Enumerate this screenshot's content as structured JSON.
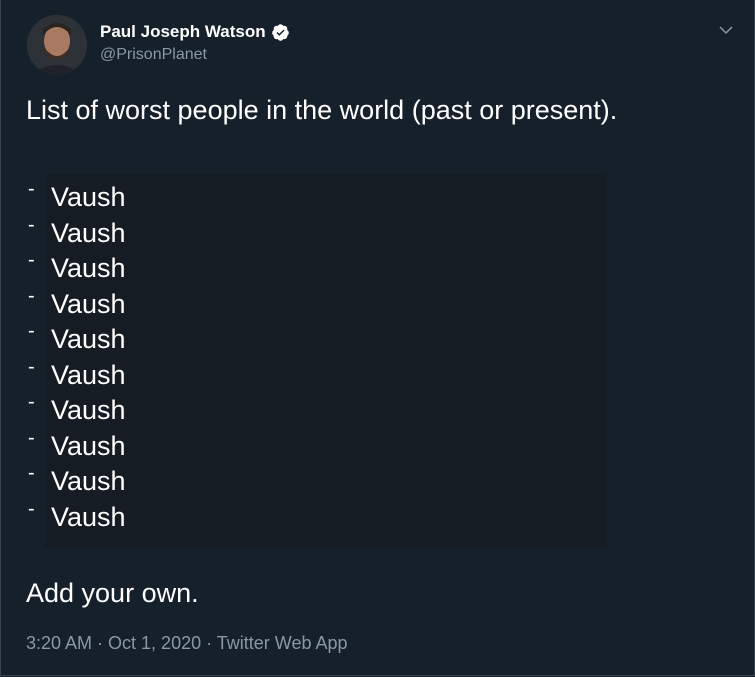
{
  "author": {
    "name": "Paul Joseph Watson",
    "handle": "@PrisonPlanet",
    "verified": true,
    "avatar_icon": "avatar-photo"
  },
  "tweet": {
    "intro": "List of worst people in the world (past or present).",
    "list_marker": "-",
    "list": [
      "Vaush",
      "Vaush",
      "Vaush",
      "Vaush",
      "Vaush",
      "Vaush",
      "Vaush",
      "Vaush",
      "Vaush",
      "Vaush"
    ],
    "outro": "Add your own."
  },
  "meta": {
    "text": "3:20 AM · Oct 1, 2020 · Twitter Web App"
  },
  "colors": {
    "background": "#15202b",
    "secondary_text": "#8899a6",
    "verified": "#ffffff",
    "code_bg": "#161c24"
  }
}
